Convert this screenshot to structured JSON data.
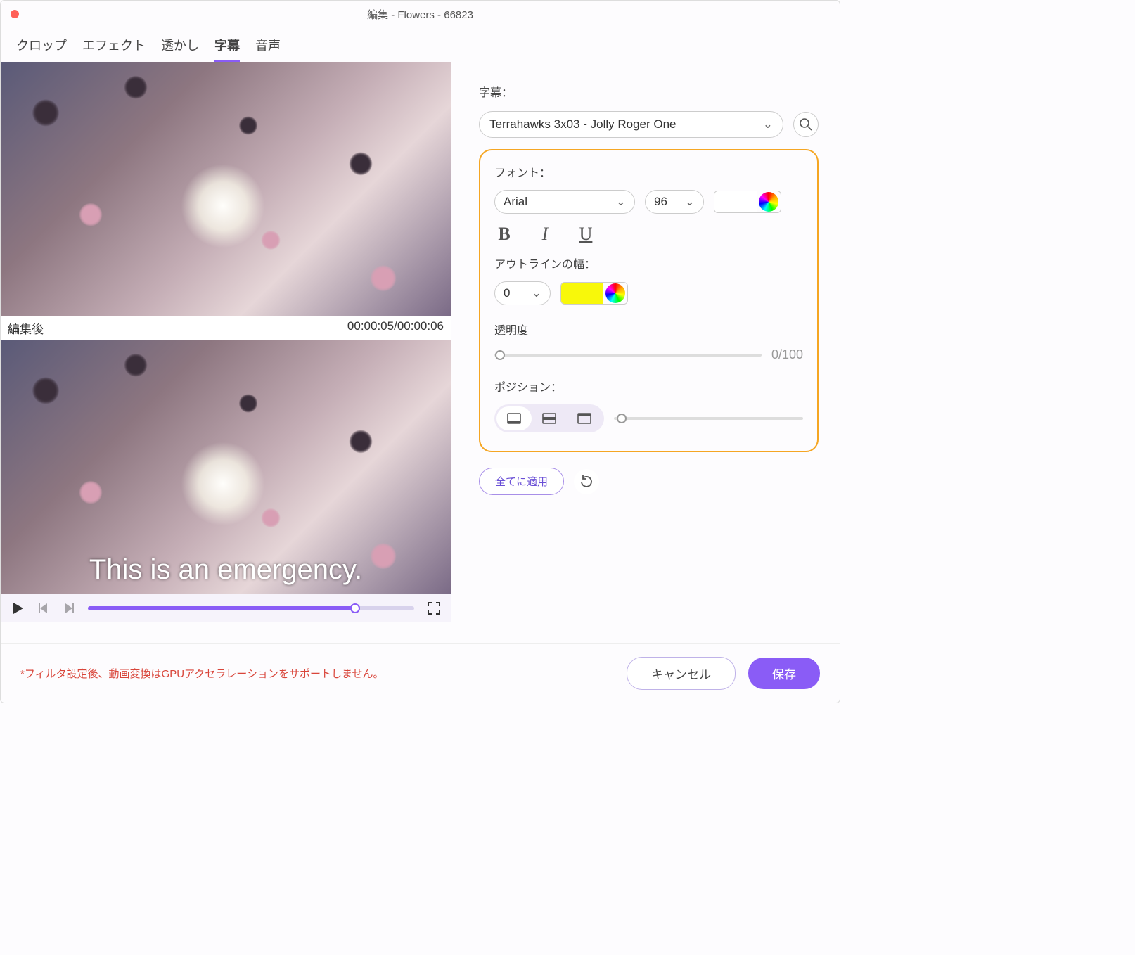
{
  "window": {
    "title": "編集 - Flowers - 66823"
  },
  "tabs": {
    "crop": "クロップ",
    "effect": "エフェクト",
    "watermark": "透かし",
    "subtitle": "字幕",
    "audio": "音声"
  },
  "preview": {
    "after_label": "編集後",
    "time": "00:00:05/00:00:06",
    "subtitle_text": "This is an emergency."
  },
  "side": {
    "subtitle_label": "字幕：",
    "subtitle_file": "Terrahawks 3x03 - Jolly Roger One",
    "font_label": "フォント：",
    "font_name": "Arial",
    "font_size": "96",
    "text_color": "#ffffff",
    "outline_label": "アウトラインの幅：",
    "outline_width": "0",
    "outline_color": "#f8f80a",
    "opacity_label": "透明度",
    "opacity_display": "0/100",
    "position_label": "ポジション：",
    "apply_all": "全てに適用"
  },
  "footer": {
    "warning": "*フィルタ設定後、動画変換はGPUアクセラレーションをサポートしません。",
    "cancel": "キャンセル",
    "save": "保存"
  }
}
